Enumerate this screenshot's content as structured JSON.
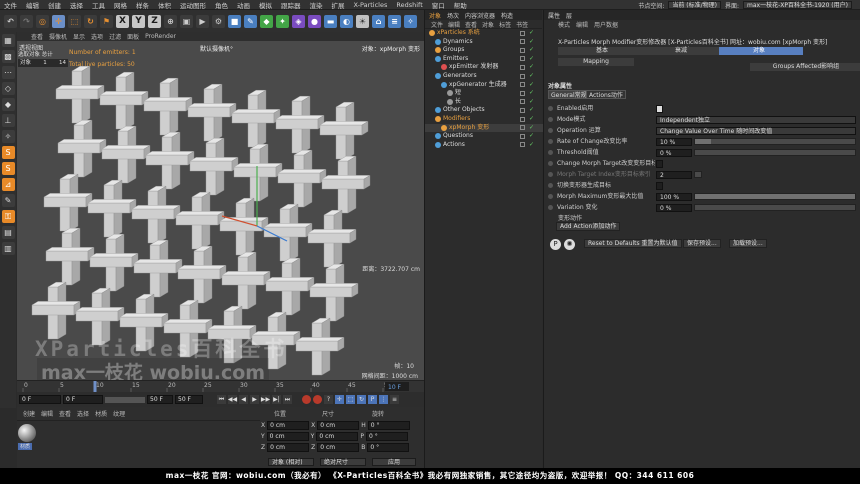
{
  "menubar": {
    "items": [
      "文件",
      "编辑",
      "创建",
      "选择",
      "工具",
      "网格",
      "样条",
      "体积",
      "运动图形",
      "角色",
      "动画",
      "模拟",
      "跟踪器",
      "渲染",
      "扩展",
      "X-Particles",
      "Redshift",
      "窗口",
      "帮助"
    ],
    "node_space_label": "节点空间:",
    "node_space_value": "当前 (标准/物理)",
    "layout_label": "界面:",
    "layout_value": "max一枝花-XP百科全书-1920 (用户)"
  },
  "toolbar": {
    "axis_x": "X",
    "axis_y": "Y",
    "axis_z": "Z"
  },
  "viewport": {
    "menu": [
      "查看",
      "摄像机",
      "显示",
      "选项",
      "过滤",
      "面板",
      "ProRender"
    ],
    "title": "透视视图",
    "camera": "默认摄像机",
    "camera_suffix": "°",
    "selected": "对象：xpMorph 变形",
    "hud_label": "选取对象 总计",
    "hud_row_label": "对象",
    "hud_row_a": "1",
    "hud_row_b": "14",
    "emitters": "Number of emitters: 1",
    "live_particles": "Total live particles: 50",
    "distance": "距离：3722.707 cm",
    "frame": "帧：10",
    "grid": "网格间距：1000 cm"
  },
  "watermark": {
    "line1": "XParticles百科全书",
    "line2": "max一枝花 wobiu.com"
  },
  "timeline": {
    "ticks": [
      "0",
      "5",
      "10",
      "15",
      "20",
      "25",
      "30",
      "35",
      "40",
      "45",
      "50"
    ],
    "current": "10 F",
    "current_frac": 0.2
  },
  "transport": {
    "start": "0 F",
    "preview_start": "0 F",
    "preview_end": "50 F",
    "end": "50 F"
  },
  "materials": {
    "menu": [
      "创建",
      "编辑",
      "查看",
      "选择",
      "材质",
      "纹理"
    ],
    "mat_name": "材质"
  },
  "coords": {
    "headers": [
      "位置",
      "尺寸",
      "旋转"
    ],
    "rows": [
      {
        "a": "X",
        "av": "0 cm",
        "b": "X",
        "bv": "0 cm",
        "c": "H",
        "cv": "0 °"
      },
      {
        "a": "Y",
        "av": "0 cm",
        "b": "Y",
        "bv": "0 cm",
        "c": "P",
        "cv": "0 °"
      },
      {
        "a": "Z",
        "av": "0 cm",
        "b": "Z",
        "bv": "0 cm",
        "c": "B",
        "cv": "0 °"
      }
    ],
    "mode": "对象 (相对)",
    "size_mode": "绝对尺寸",
    "apply": "应用"
  },
  "objects": {
    "tabs": [
      "对象",
      "场次",
      "内容浏览器",
      "构造"
    ],
    "menu": [
      "文件",
      "编辑",
      "查看",
      "对象",
      "标签",
      "书签"
    ],
    "items": [
      {
        "label": "xParticles 系统",
        "indent": 0,
        "color": "#e8a040",
        "text": "#e8a040"
      },
      {
        "label": "Dynamics",
        "indent": 1,
        "color": "#4f9ed8",
        "text": "#ddd"
      },
      {
        "label": "Groups",
        "indent": 1,
        "color": "#e8a040",
        "text": "#ddd"
      },
      {
        "label": "Emitters",
        "indent": 1,
        "color": "#4f9ed8",
        "text": "#ddd"
      },
      {
        "label": "xpEmitter 发射器",
        "indent": 2,
        "color": "#e05050",
        "text": "#ddd"
      },
      {
        "label": "Generators",
        "indent": 1,
        "color": "#4f9ed8",
        "text": "#ddd"
      },
      {
        "label": "xpGenerator 生成器",
        "indent": 2,
        "color": "#4f9ed8",
        "text": "#ddd"
      },
      {
        "label": "短",
        "indent": 3,
        "color": "#999",
        "text": "#ddd"
      },
      {
        "label": "长",
        "indent": 3,
        "color": "#999",
        "text": "#ddd"
      },
      {
        "label": "Other Objects",
        "indent": 1,
        "color": "#4f9ed8",
        "text": "#ddd"
      },
      {
        "label": "Modifiers",
        "indent": 1,
        "color": "#e8a040",
        "text": "#e8a040"
      },
      {
        "label": "xpMorph 变形",
        "indent": 2,
        "color": "#e8a040",
        "text": "#e8a040"
      },
      {
        "label": "Questions",
        "indent": 1,
        "color": "#4f9ed8",
        "text": "#ddd"
      },
      {
        "label": "Actions",
        "indent": 1,
        "color": "#4f9ed8",
        "text": "#ddd"
      }
    ]
  },
  "attributes": {
    "tabs": [
      "属性",
      "层"
    ],
    "menu": [
      "模式",
      "编辑",
      "用户数据"
    ],
    "header": "X-Particles Morph Modifier变形修改器 [X-Particles百科全书] 网址：wobiu.com [xpMorph 变形]",
    "obj_tabs": [
      "基本",
      "坐标",
      "对象",
      "Groups Affected影响组",
      "Mapping",
      "衰减"
    ],
    "section": "对象属性",
    "subtabs": [
      "General常规",
      "Actions动作"
    ],
    "params": [
      {
        "label": "Enabled启用",
        "value": "",
        "kind": "check"
      },
      {
        "label": "Mode模式",
        "value": "Independent独立",
        "kind": "drop"
      },
      {
        "label": "Operation 运算",
        "value": "Change Value Over Time 随时间改变值",
        "kind": "drop"
      },
      {
        "label": "Rate of Change改变比率",
        "value": "10 %",
        "kind": "slider",
        "fill": 0.1
      },
      {
        "label": "Threshold阈值",
        "value": "0 %",
        "kind": "slider",
        "fill": 0
      },
      {
        "label": "Change Morph Target改变变形目标",
        "value": "",
        "kind": "check"
      },
      {
        "label": "Morph Target Index变形目标索引",
        "value": "2",
        "kind": "dimnum"
      },
      {
        "label": "切换变形器生成目标",
        "value": "",
        "kind": "check"
      },
      {
        "label": "Morph Maximum变形最大比值",
        "value": "100 %",
        "kind": "slider",
        "fill": 1
      },
      {
        "label": "Variation 变化",
        "value": "0 %",
        "kind": "slider",
        "fill": 0
      }
    ],
    "actions_label": "变形动作",
    "add_action": "Add Action添加动作",
    "reset": "Reset to Defaults 重置为默认值",
    "save_preset": "保存预设...",
    "load_preset": "加载预设..."
  },
  "footer": "max一枝花 官网：wobiu.com（我必有）  《X-Particles百科全书》我必有网独家销售，其它途径均为盗版，欢迎举报！  QQ：344 611 606"
}
